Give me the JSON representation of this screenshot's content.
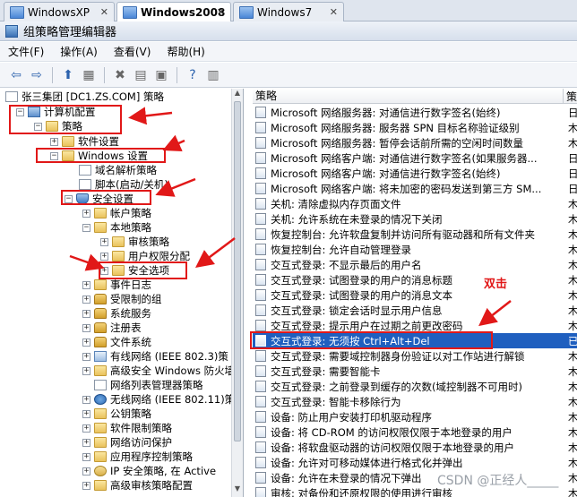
{
  "vm_tabs": [
    {
      "label": "WindowsXP",
      "close": "✕"
    },
    {
      "label": "Windows2008",
      "close": "✕"
    },
    {
      "label": "Windows7",
      "close": "✕"
    }
  ],
  "window": {
    "title": "组策略管理编辑器"
  },
  "menu": [
    "文件(F)",
    "操作(A)",
    "查看(V)",
    "帮助(H)"
  ],
  "toolbar_icons": [
    "back-arrow-icon",
    "forward-arrow-icon",
    "up-folder-icon",
    "show-hide-tree-icon",
    "delete-icon",
    "properties-icon",
    "export-list-icon",
    "help-icon",
    "show-pane-icon"
  ],
  "tree": {
    "root": "张三集团 [DC1.ZS.COM] 策略",
    "nodes": [
      {
        "label": "计算机配置",
        "expander": "−"
      },
      {
        "label": "策略",
        "expander": "−"
      },
      {
        "label": "软件设置",
        "expander": "+"
      },
      {
        "label": "Windows 设置",
        "expander": "−"
      },
      {
        "label": "域名解析策略",
        "expander": ""
      },
      {
        "label": "脚本(启动/关机)",
        "expander": ""
      },
      {
        "label": "安全设置",
        "expander": "−"
      },
      {
        "label": "帐户策略",
        "expander": "+"
      },
      {
        "label": "本地策略",
        "expander": "−"
      },
      {
        "label": "审核策略",
        "expander": "+"
      },
      {
        "label": "用户权限分配",
        "expander": "+"
      },
      {
        "label": "安全选项",
        "expander": "+"
      },
      {
        "label": "事件日志",
        "expander": "+"
      },
      {
        "label": "受限制的组",
        "expander": "+"
      },
      {
        "label": "系统服务",
        "expander": "+"
      },
      {
        "label": "注册表",
        "expander": "+"
      },
      {
        "label": "文件系统",
        "expander": "+"
      },
      {
        "label": "有线网络 (IEEE 802.3)策",
        "expander": "+"
      },
      {
        "label": "高级安全 Windows 防火墙",
        "expander": "+"
      },
      {
        "label": "网络列表管理器策略",
        "expander": ""
      },
      {
        "label": "无线网络 (IEEE 802.11)策",
        "expander": "+"
      },
      {
        "label": "公钥策略",
        "expander": "+"
      },
      {
        "label": "软件限制策略",
        "expander": "+"
      },
      {
        "label": "网络访问保护",
        "expander": "+"
      },
      {
        "label": "应用程序控制策略",
        "expander": "+"
      },
      {
        "label": "IP 安全策略, 在 Active",
        "expander": "+"
      },
      {
        "label": "高级审核策略配置",
        "expander": "+"
      }
    ]
  },
  "list": {
    "header": "策略",
    "header2": "策",
    "rows": [
      {
        "text": "Microsoft 网络服务器: 对通信进行数字签名(始终)",
        "val": "日"
      },
      {
        "text": "Microsoft 网络服务器: 服务器 SPN 目标名称验证级别",
        "val": "木"
      },
      {
        "text": "Microsoft 网络服务器: 暂停会话前所需的空闲时间数量",
        "val": "木"
      },
      {
        "text": "Microsoft 网络客户端: 对通信进行数字签名(如果服务器...",
        "val": "日"
      },
      {
        "text": "Microsoft 网络客户端: 对通信进行数字签名(始终)",
        "val": "日"
      },
      {
        "text": "Microsoft 网络客户端: 将未加密的密码发送到第三方 SM...",
        "val": "日"
      },
      {
        "text": "关机: 清除虚拟内存页面文件",
        "val": "木"
      },
      {
        "text": "关机: 允许系统在未登录的情况下关闭",
        "val": "木"
      },
      {
        "text": "恢复控制台: 允许软盘复制并访问所有驱动器和所有文件夹",
        "val": "木"
      },
      {
        "text": "恢复控制台: 允许自动管理登录",
        "val": "木"
      },
      {
        "text": "交互式登录: 不显示最后的用户名",
        "val": "木"
      },
      {
        "text": "交互式登录: 试图登录的用户的消息标题",
        "val": "木"
      },
      {
        "text": "交互式登录: 试图登录的用户的消息文本",
        "val": "木"
      },
      {
        "text": "交互式登录: 锁定会话时显示用户信息",
        "val": "木"
      },
      {
        "text": "交互式登录: 提示用户在过期之前更改密码",
        "val": "木"
      },
      {
        "text": "交互式登录: 无须按 Ctrl+Alt+Del",
        "val": "已"
      },
      {
        "text": "交互式登录: 需要域控制器身份验证以对工作站进行解锁",
        "val": "木"
      },
      {
        "text": "交互式登录: 需要智能卡",
        "val": "木"
      },
      {
        "text": "交互式登录: 之前登录到缓存的次数(域控制器不可用时)",
        "val": "木"
      },
      {
        "text": "交互式登录: 智能卡移除行为",
        "val": "木"
      },
      {
        "text": "设备: 防止用户安装打印机驱动程序",
        "val": "木"
      },
      {
        "text": "设备: 将 CD-ROM 的访问权限仅限于本地登录的用户",
        "val": "木"
      },
      {
        "text": "设备: 将软盘驱动器的访问权限仅限于本地登录的用户",
        "val": "木"
      },
      {
        "text": "设备: 允许对可移动媒体进行格式化并弹出",
        "val": "木"
      },
      {
        "text": "设备: 允许在未登录的情况下弹出",
        "val": "木"
      },
      {
        "text": "审核: 对备份和还原权限的使用进行审核",
        "val": "木"
      }
    ]
  },
  "annotation": {
    "label": "双击",
    "color": "#e11818"
  },
  "watermark": "CSDN @正经人_____"
}
